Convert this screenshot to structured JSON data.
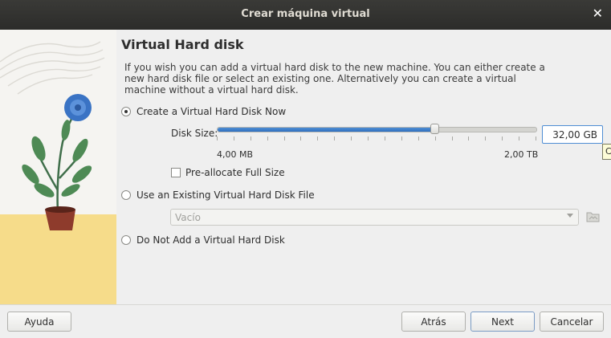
{
  "window": {
    "title": "Crear máquina virtual"
  },
  "page": {
    "heading": "Virtual Hard disk",
    "description": "If you wish you can add a virtual hard disk to the new machine. You can either create a new hard disk file or select an existing one. Alternatively you can create a virtual machine without a virtual hard disk."
  },
  "options": {
    "create_now": {
      "label": "Create a Virtual Hard Disk Now",
      "selected": true
    },
    "use_existing": {
      "label": "Use an Existing Virtual Hard Disk File",
      "selected": false
    },
    "do_not_add": {
      "label": "Do Not Add a Virtual Hard Disk",
      "selected": false
    }
  },
  "disk_size": {
    "label": "Disk Size:",
    "value": "32,00 GB",
    "min_label": "4,00 MB",
    "max_label": "2,00 TB",
    "slider_fraction": 0.68,
    "tooltip_text": "C"
  },
  "preallocate": {
    "label": "Pre-allocate Full Size",
    "checked": false
  },
  "existing_file": {
    "selected": "Vacío"
  },
  "buttons": {
    "help": "Ayuda",
    "back": "Atrás",
    "next": "Next",
    "cancel": "Cancelar"
  },
  "colors": {
    "accent": "#3479c8",
    "illustration_floor": "#f6dc8a",
    "titlebar": "#333331"
  }
}
